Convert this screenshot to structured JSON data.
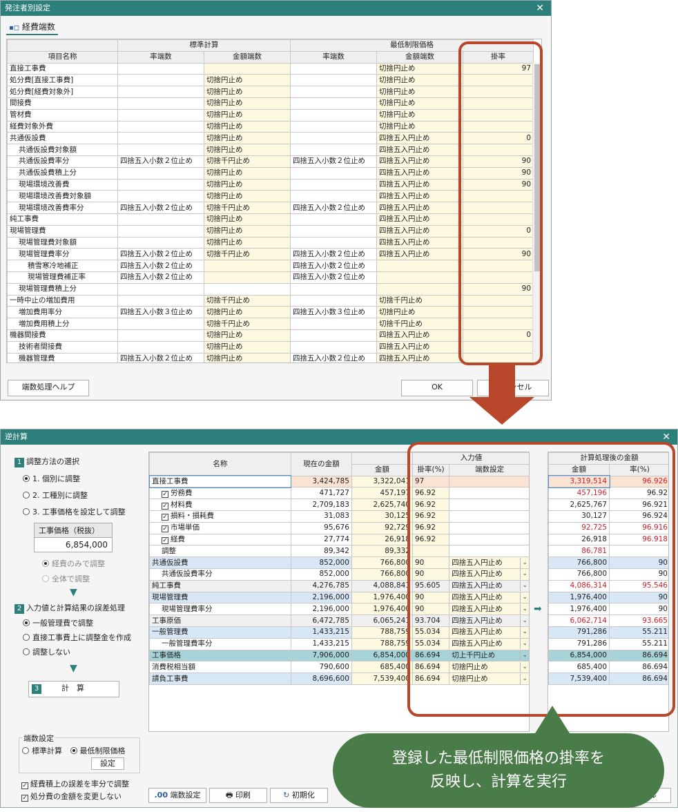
{
  "top_window": {
    "title": "発注者別設定",
    "tab": "経費端数",
    "group_standard": "標準計算",
    "group_minimum": "最低制限価格",
    "col_name": "項目名称",
    "col_rate_round": "率端数",
    "col_amount_round": "金額端数",
    "col_rate_round2": "率端数",
    "col_amount_round2": "金額端数",
    "col_kakeritsu": "掛率",
    "rows": [
      {
        "name": "直接工事費",
        "i": 0,
        "a": "",
        "b": "",
        "c": "",
        "d": "切捨円止め",
        "e": "97"
      },
      {
        "name": "処分費[直接工事費]",
        "i": 0,
        "a": "",
        "b": "切捨円止め",
        "c": "",
        "d": "切捨円止め",
        "e": ""
      },
      {
        "name": "処分費[経費対象外]",
        "i": 0,
        "a": "",
        "b": "切捨円止め",
        "c": "",
        "d": "切捨円止め",
        "e": ""
      },
      {
        "name": "間接費",
        "i": 0,
        "a": "",
        "b": "切捨円止め",
        "c": "",
        "d": "切捨円止め",
        "e": ""
      },
      {
        "name": "管材費",
        "i": 0,
        "a": "",
        "b": "切捨円止め",
        "c": "",
        "d": "切捨円止め",
        "e": ""
      },
      {
        "name": "経費対象外費",
        "i": 0,
        "a": "",
        "b": "切捨円止め",
        "c": "",
        "d": "切捨円止め",
        "e": ""
      },
      {
        "name": "共通仮設費",
        "i": 0,
        "a": "",
        "b": "切捨円止め",
        "c": "",
        "d": "四捨五入円止め",
        "e": "0"
      },
      {
        "name": "共通仮設費対象額",
        "i": 1,
        "a": "",
        "b": "切捨円止め",
        "c": "",
        "d": "四捨五入円止め",
        "e": ""
      },
      {
        "name": "共通仮設費率分",
        "i": 1,
        "a": "四捨五入小数２位止め",
        "b": "切捨千円止め",
        "c": "四捨五入小数２位止め",
        "d": "四捨五入円止め",
        "e": "90"
      },
      {
        "name": "共通仮設費積上分",
        "i": 1,
        "a": "",
        "b": "切捨円止め",
        "c": "",
        "d": "四捨五入円止め",
        "e": "90"
      },
      {
        "name": "現場環境改善費",
        "i": 1,
        "a": "",
        "b": "切捨円止め",
        "c": "",
        "d": "四捨五入円止め",
        "e": "90"
      },
      {
        "name": "現場環境改善費対象額",
        "i": 1,
        "a": "",
        "b": "切捨円止め",
        "c": "",
        "d": "四捨五入円止め",
        "e": ""
      },
      {
        "name": "現場環境改善費率分",
        "i": 1,
        "a": "四捨五入小数２位止め",
        "b": "切捨千円止め",
        "c": "四捨五入小数２位止め",
        "d": "四捨五入円止め",
        "e": ""
      },
      {
        "name": "純工事費",
        "i": 0,
        "a": "",
        "b": "切捨円止め",
        "c": "",
        "d": "四捨五入円止め",
        "e": ""
      },
      {
        "name": "現場管理費",
        "i": 0,
        "a": "",
        "b": "切捨円止め",
        "c": "",
        "d": "四捨五入円止め",
        "e": "0"
      },
      {
        "name": "現場管理費対象額",
        "i": 1,
        "a": "",
        "b": "切捨円止め",
        "c": "",
        "d": "四捨五入円止め",
        "e": ""
      },
      {
        "name": "現場管理費率分",
        "i": 1,
        "a": "四捨五入小数２位止め",
        "b": "切捨千円止め",
        "c": "四捨五入小数２位止め",
        "d": "四捨五入円止め",
        "e": "90"
      },
      {
        "name": "積雪寒冷地補正",
        "i": 2,
        "a": "四捨五入小数２位止め",
        "b": "",
        "c": "四捨五入小数２位止め",
        "d": "",
        "e": ""
      },
      {
        "name": "現場管理費補正率",
        "i": 2,
        "a": "四捨五入小数２位止め",
        "b": "",
        "c": "四捨五入小数２位止め",
        "d": "",
        "e": ""
      },
      {
        "name": "現場管理費積上分",
        "i": 1,
        "a": "",
        "b": "",
        "c": "",
        "d": "",
        "e": "90"
      },
      {
        "name": "一時中止の増加費用",
        "i": 0,
        "a": "",
        "b": "切捨千円止め",
        "c": "",
        "d": "切捨千円止め",
        "e": ""
      },
      {
        "name": "増加費用率分",
        "i": 1,
        "a": "四捨五入小数３位止め",
        "b": "切捨円止め",
        "c": "四捨五入小数３位止め",
        "d": "切捨円止め",
        "e": ""
      },
      {
        "name": "増加費用積上分",
        "i": 1,
        "a": "",
        "b": "切捨千円止め",
        "c": "",
        "d": "切捨千円止め",
        "e": ""
      },
      {
        "name": "機器間接費",
        "i": 0,
        "a": "",
        "b": "切捨円止め",
        "c": "",
        "d": "四捨五入円止め",
        "e": "0"
      },
      {
        "name": "技術者間接費",
        "i": 1,
        "a": "",
        "b": "切捨円止め",
        "c": "",
        "d": "四捨五入円止め",
        "e": ""
      },
      {
        "name": "機器管理費",
        "i": 1,
        "a": "四捨五入小数２位止め",
        "b": "切捨円止め",
        "c": "四捨五入小数２位止め",
        "d": "四捨五入円止め",
        "e": ""
      }
    ],
    "help_button": "端数処理ヘルプ",
    "ok_button": "OK",
    "cancel_button": "キャンセル"
  },
  "bottom_window": {
    "title": "逆計算",
    "step1": "調整方法の選択",
    "step1_num": "1",
    "opt1": "1. 個別に調整",
    "opt2": "2. 工種別に調整",
    "opt3": "3. 工事価格を設定して調整",
    "price_label": "工事価格（税抜）",
    "price_value": "6,854,000",
    "sub_opt1": "経費のみで調整",
    "sub_opt2": "全体で調整",
    "step2": "入力値と計算結果の誤差処理",
    "step2_num": "2",
    "err1": "一般管理費で調整",
    "err2": "直接工事費上に調整金を作成",
    "err3": "調整しない",
    "step3_num": "3",
    "calc_button": "計　算",
    "rounding_group": "端数設定",
    "round_std": "標準計算",
    "round_min": "最低制限価格",
    "settings_button": "設定",
    "check1": "経費積上の誤差を率分で調整",
    "check2": "処分費の金額を変更しない",
    "h_name": "名称",
    "h_current": "現在の金額",
    "h_input": "入力値",
    "h_amount": "金額",
    "h_rate": "掛率(%)",
    "h_round": "端数設定",
    "h_result": "計算処理後の金額",
    "h_ramount": "金額",
    "h_rrate": "率(%)",
    "rows": [
      {
        "name": "直接工事費",
        "i": 0,
        "chk": false,
        "cur": "3,424,785",
        "amt": "3,322,041",
        "rate": "97",
        "round": "",
        "ramt": "3,319,514",
        "rrate": "96.926",
        "ramt_red": true,
        "rrate_red": true,
        "cls": "first"
      },
      {
        "name": "労務費",
        "i": 1,
        "chk": true,
        "cur": "471,727",
        "amt": "457,197",
        "rate": "96.92",
        "round": "",
        "ramt": "457,196",
        "rrate": "96.92",
        "ramt_red": true,
        "rrate_red": false,
        "cls": ""
      },
      {
        "name": "材料費",
        "i": 1,
        "chk": true,
        "cur": "2,709,183",
        "amt": "2,625,740",
        "rate": "96.92",
        "round": "",
        "ramt": "2,625,767",
        "rrate": "96.921",
        "ramt_red": false,
        "rrate_red": false,
        "cls": ""
      },
      {
        "name": "損料・損耗費",
        "i": 1,
        "chk": true,
        "cur": "31,083",
        "amt": "30,125",
        "rate": "96.92",
        "round": "",
        "ramt": "30,127",
        "rrate": "96.924",
        "ramt_red": false,
        "rrate_red": false,
        "cls": ""
      },
      {
        "name": "市場単価",
        "i": 1,
        "chk": true,
        "cur": "95,676",
        "amt": "92,729",
        "rate": "96.92",
        "round": "",
        "ramt": "92,725",
        "rrate": "96.916",
        "ramt_red": true,
        "rrate_red": true,
        "cls": ""
      },
      {
        "name": "経費",
        "i": 1,
        "chk": true,
        "cur": "27,774",
        "amt": "26,918",
        "rate": "96.92",
        "round": "",
        "ramt": "26,918",
        "rrate": "96.918",
        "ramt_red": false,
        "rrate_red": true,
        "cls": ""
      },
      {
        "name": "調整",
        "i": 1,
        "chk": false,
        "cur": "89,342",
        "amt": "89,332",
        "rate": "",
        "round": "",
        "ramt": "86,781",
        "rrate": "",
        "ramt_red": true,
        "rrate_red": false,
        "cls": ""
      },
      {
        "name": "共通仮設費",
        "i": 0,
        "chk": false,
        "cur": "852,000",
        "amt": "766,800",
        "rate": "90",
        "round": "四捨五入円止め",
        "ramt": "766,800",
        "rrate": "90",
        "ramt_red": false,
        "rrate_red": false,
        "cls": "blue"
      },
      {
        "name": "共通仮設費率分",
        "i": 1,
        "chk": false,
        "cur": "852,000",
        "amt": "766,800",
        "rate": "90",
        "round": "四捨五入円止め",
        "ramt": "766,800",
        "rrate": "90",
        "ramt_red": false,
        "rrate_red": false,
        "cls": ""
      },
      {
        "name": "純工事費",
        "i": 0,
        "chk": false,
        "cur": "4,276,785",
        "amt": "4,088,841",
        "rate": "95.605",
        "round": "四捨五入円止め",
        "ramt": "4,086,314",
        "rrate": "95.546",
        "ramt_red": true,
        "rrate_red": true,
        "cls": "gray"
      },
      {
        "name": "現場管理費",
        "i": 0,
        "chk": false,
        "cur": "2,196,000",
        "amt": "1,976,400",
        "rate": "90",
        "round": "四捨五入円止め",
        "ramt": "1,976,400",
        "rrate": "90",
        "ramt_red": false,
        "rrate_red": false,
        "cls": "blue"
      },
      {
        "name": "現場管理費率分",
        "i": 1,
        "chk": false,
        "cur": "2,196,000",
        "amt": "1,976,400",
        "rate": "90",
        "round": "四捨五入円止め",
        "ramt": "1,976,400",
        "rrate": "90",
        "ramt_red": false,
        "rrate_red": false,
        "cls": ""
      },
      {
        "name": "工事原価",
        "i": 0,
        "chk": false,
        "cur": "6,472,785",
        "amt": "6,065,241",
        "rate": "93.704",
        "round": "四捨五入円止め",
        "ramt": "6,062,714",
        "rrate": "93.665",
        "ramt_red": true,
        "rrate_red": true,
        "cls": "gray"
      },
      {
        "name": "一般管理費",
        "i": 0,
        "chk": false,
        "cur": "1,433,215",
        "amt": "788,759",
        "rate": "55.034",
        "round": "四捨五入円止め",
        "ramt": "791,286",
        "rrate": "55.211",
        "ramt_red": false,
        "rrate_red": false,
        "cls": "blue"
      },
      {
        "name": "一般管理費率分",
        "i": 1,
        "chk": false,
        "cur": "1,433,215",
        "amt": "788,759",
        "rate": "55.034",
        "round": "四捨五入円止め",
        "ramt": "791,286",
        "rrate": "55.211",
        "ramt_red": false,
        "rrate_red": false,
        "cls": ""
      },
      {
        "name": "工事価格",
        "i": 0,
        "chk": false,
        "cur": "7,906,000",
        "amt": "6,854,000",
        "rate": "86.694",
        "round": "切上千円止め",
        "ramt": "6,854,000",
        "rrate": "86.694",
        "ramt_red": false,
        "rrate_red": false,
        "cls": "teal"
      },
      {
        "name": "消費税相当額",
        "i": 0,
        "chk": false,
        "cur": "790,600",
        "amt": "685,400",
        "rate": "86.694",
        "round": "切捨円止め",
        "ramt": "685,400",
        "rrate": "86.694",
        "ramt_red": false,
        "rrate_red": false,
        "cls": ""
      },
      {
        "name": "請負工事費",
        "i": 0,
        "chk": false,
        "cur": "8,696,600",
        "amt": "7,539,400",
        "rate": "86.694",
        "round": "切捨円止め",
        "ramt": "7,539,400",
        "rrate": "86.694",
        "ramt_red": false,
        "rrate_red": false,
        "cls": "blue"
      }
    ],
    "btn_round": "端数設定",
    "btn_print": "印刷",
    "btn_init": "初期化",
    "btn_cancel": "ャンセル"
  },
  "callout_line1": "登録した最低制限価格の掛率を",
  "callout_line2": "反映し、計算を実行",
  "colors": {
    "accent": "#b7462a",
    "callout": "#4a7c4a",
    "title": "#2d7f7b"
  }
}
